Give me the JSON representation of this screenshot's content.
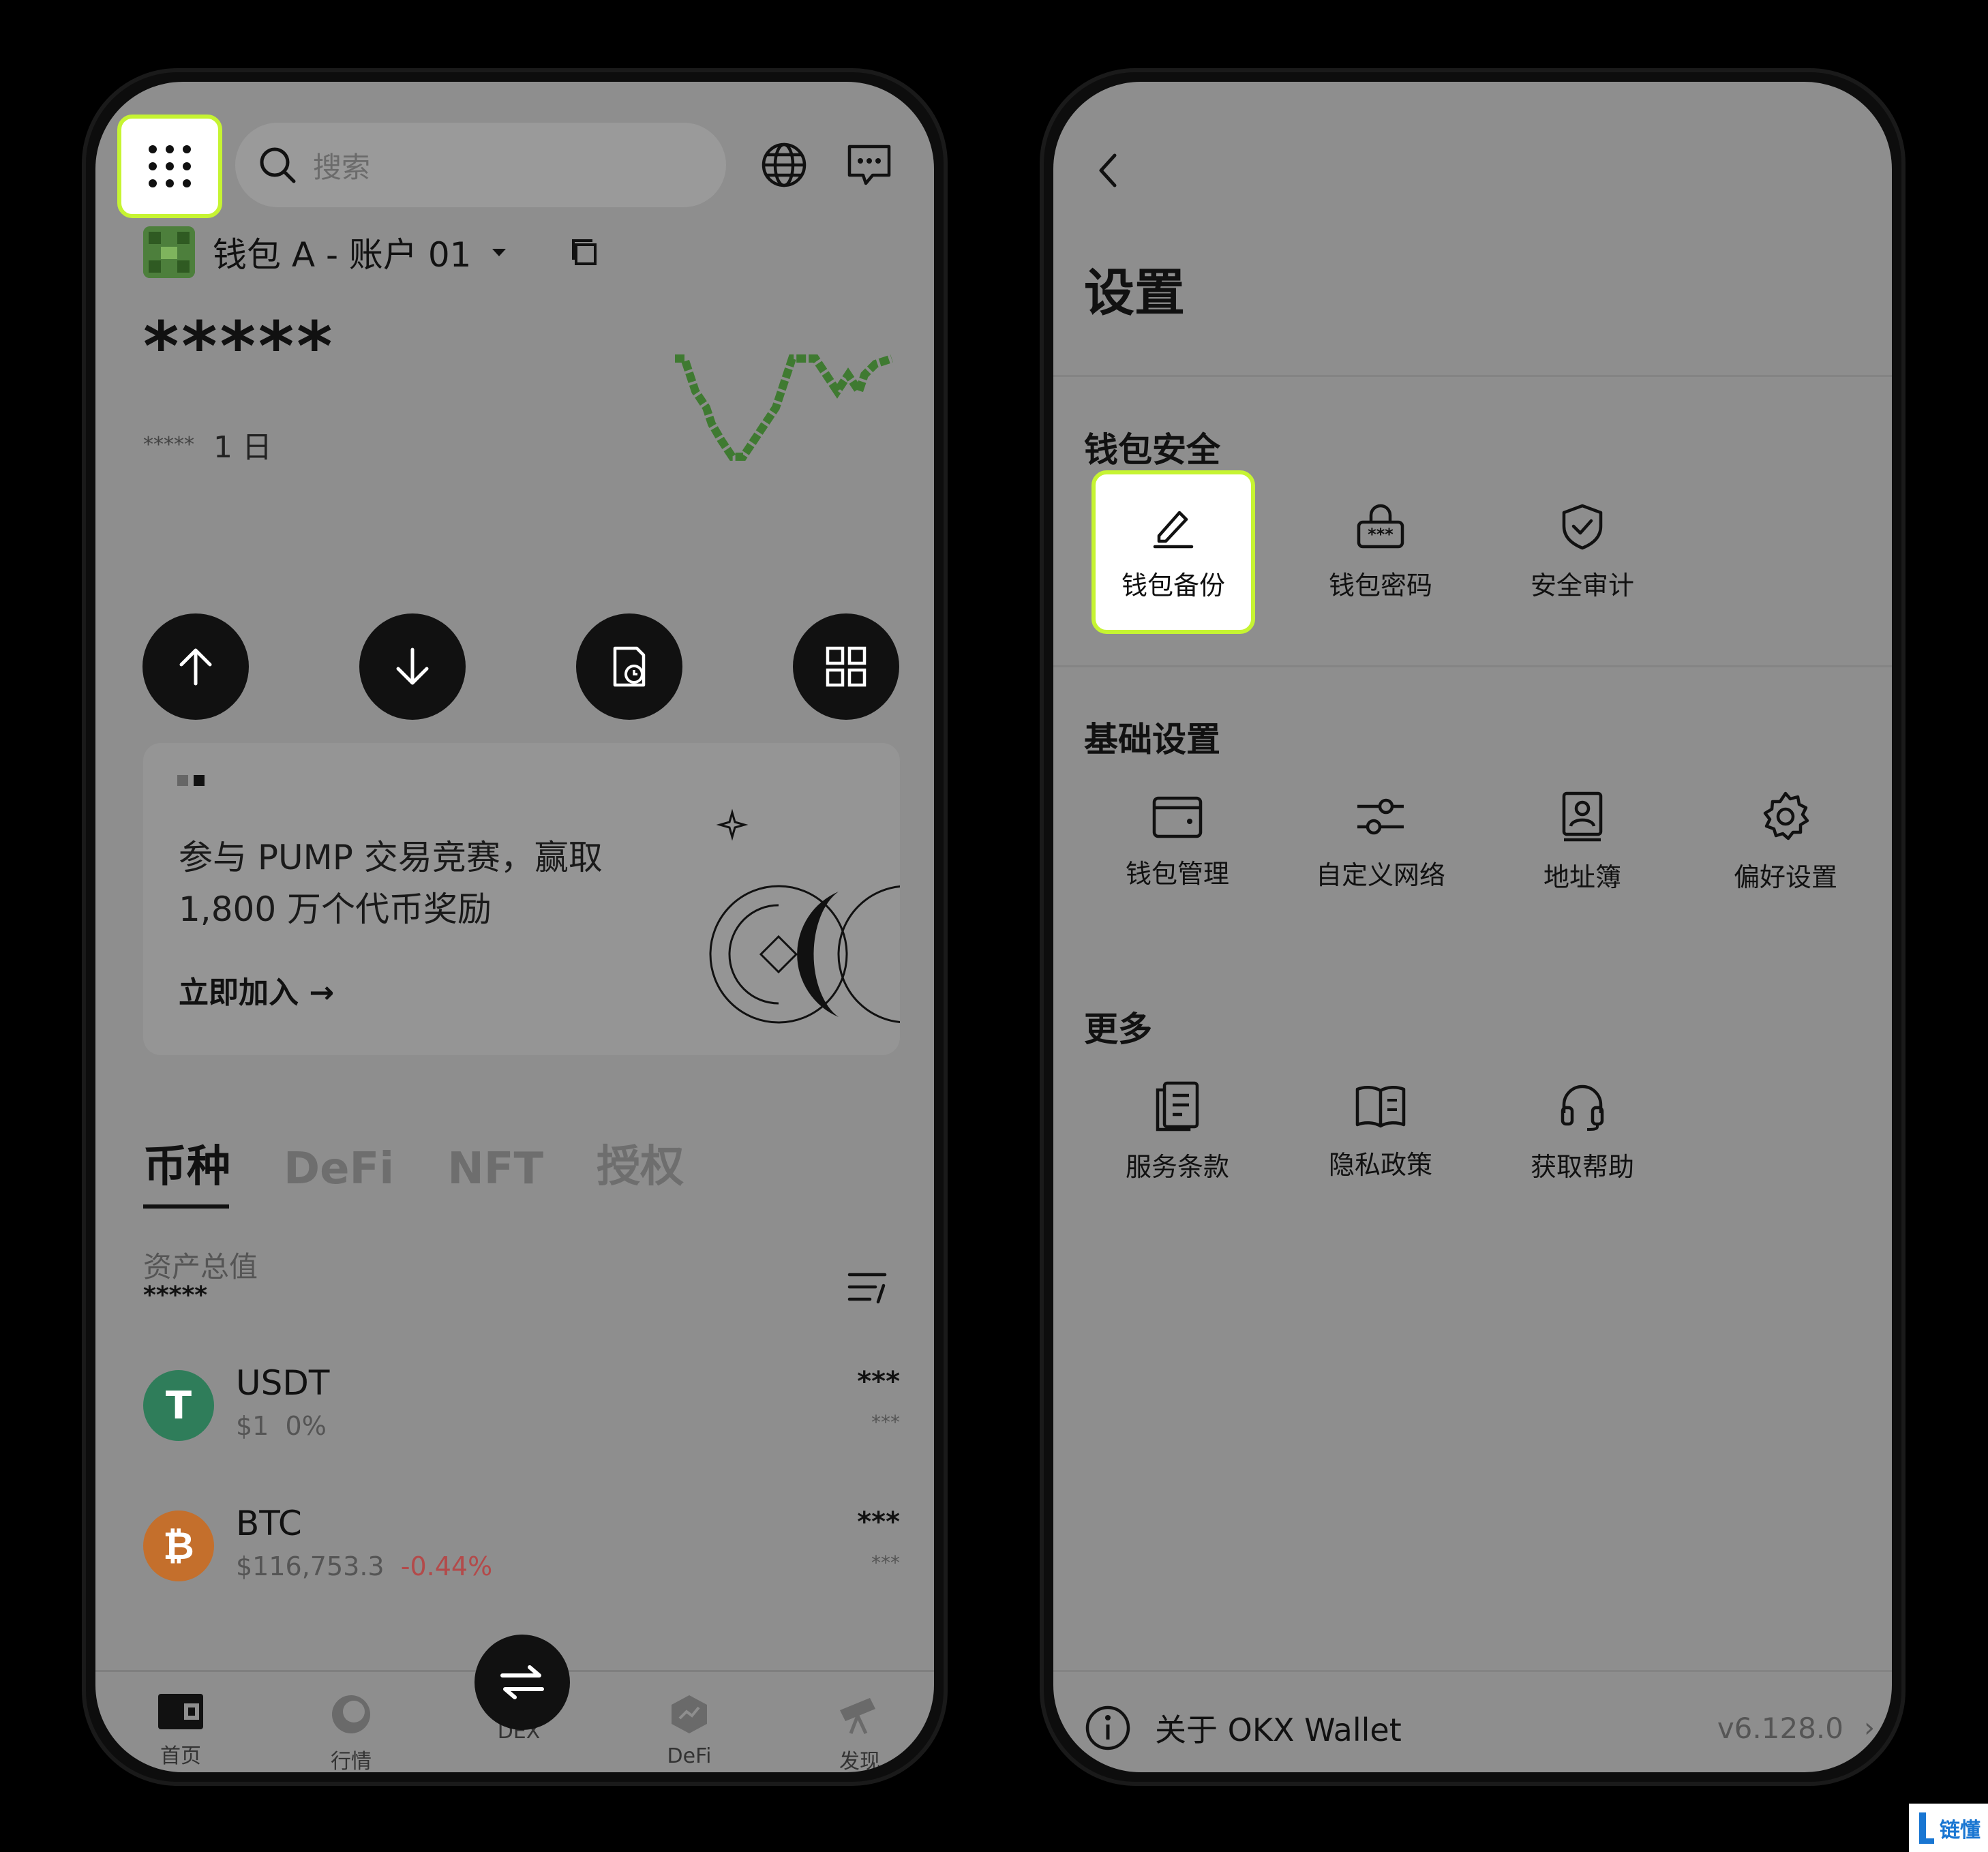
{
  "left": {
    "search_placeholder": "搜索",
    "account_name": "钱包 A - 账户 01",
    "balance_masked": "*****",
    "balance_change_masked": "*****",
    "period": "1 日",
    "actions": [
      {
        "label": "发送"
      },
      {
        "label": "接收"
      },
      {
        "label": "交易历史"
      },
      {
        "label": "更多"
      }
    ],
    "banner": {
      "text": "参与 PUMP 交易竞赛，赢取 1,800 万个代币奖励",
      "link": "立即加入 →"
    },
    "tabs": [
      "币种",
      "DeFi",
      "NFT",
      "授权"
    ],
    "assets_label": "资产总值",
    "assets_masked": "*****",
    "coins": [
      {
        "name": "USDT",
        "price": "$1",
        "change": "0%",
        "amount": "***",
        "amount_sub": "***",
        "symbol": "T",
        "color": "#2f7d5a"
      },
      {
        "name": "BTC",
        "price": "$116,753.3",
        "change": "-0.44%",
        "amount": "***",
        "amount_sub": "***",
        "symbol": "₿",
        "color": "#c46f2c"
      }
    ],
    "nav": [
      {
        "label": "首页"
      },
      {
        "label": "行情"
      },
      {
        "label": "DEX"
      },
      {
        "label": "DeFi"
      },
      {
        "label": "发现"
      }
    ]
  },
  "right": {
    "title": "设置",
    "sections": [
      {
        "title": "钱包安全",
        "items": [
          "钱包备份",
          "钱包密码",
          "安全审计"
        ]
      },
      {
        "title": "基础设置",
        "items": [
          "钱包管理",
          "自定义网络",
          "地址簿",
          "偏好设置"
        ]
      },
      {
        "title": "更多",
        "items": [
          "服务条款",
          "隐私政策",
          "获取帮助"
        ]
      }
    ],
    "about_label": "关于 OKX Wallet",
    "version": "v6.128.0"
  },
  "watermark": "链懂",
  "colors": {
    "highlight": "#c6f432",
    "screen_overlay": "#8e8e8e",
    "chart_green": "#4a7d3a",
    "negative": "#b34a4a"
  }
}
